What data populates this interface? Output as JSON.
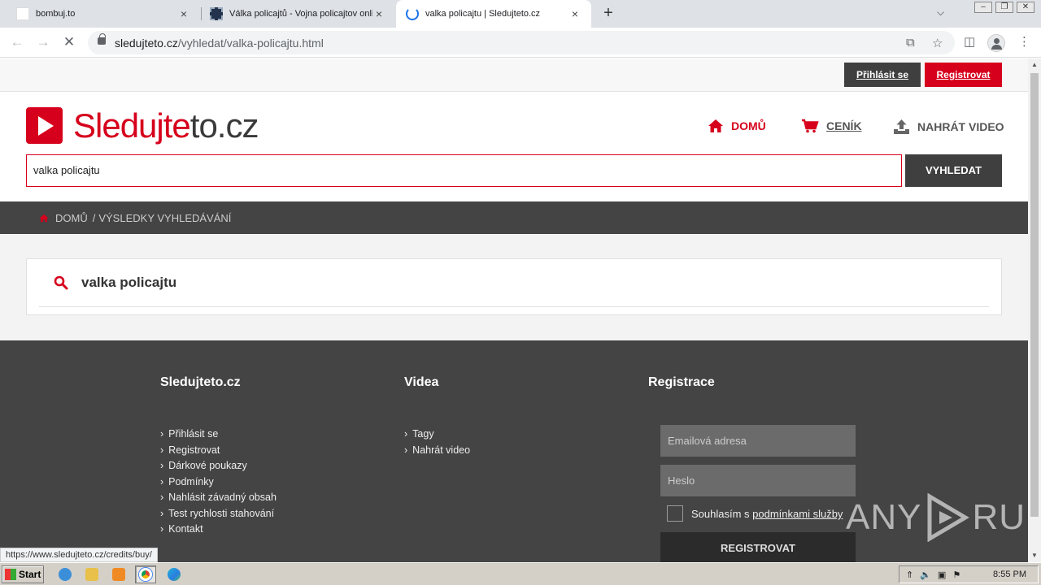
{
  "browser": {
    "tabs": [
      {
        "title": "bombuj.to",
        "close": "×"
      },
      {
        "title": "Válka policajtů - Vojna policajtov online",
        "close": "×"
      },
      {
        "title": "valka policajtu | Sledujteto.cz",
        "close": "×"
      }
    ],
    "new_tab": "+",
    "url_host": "sledujteto.cz",
    "url_path": "/vyhledat/valka-policajtu.html",
    "status_url": "https://www.sledujteto.cz/credits/buy/"
  },
  "site": {
    "logo_red": "Sledujte",
    "logo_dark": "to.cz",
    "login_label": "Přihlásit se",
    "register_label": "Registrovat",
    "nav": {
      "home": "DOMŮ",
      "pricing": "CENÍK",
      "upload": "NAHRÁT VIDEO"
    },
    "search": {
      "value": "valka policajtu",
      "button": "VYHLEDAT"
    },
    "breadcrumb": {
      "home": "DOMŮ",
      "separator": "/",
      "current": "VÝSLEDKY VYHLEDÁVÁNÍ"
    },
    "result_query": "valka policajtu",
    "accent_color": "#d6001c"
  },
  "footer": {
    "col1": {
      "title": "Sledujteto.cz",
      "links": [
        "Přihlásit se",
        "Registrovat",
        "Dárkové poukazy",
        "Podmínky",
        "Nahlásit závadný obsah",
        "Test rychlosti stahování",
        "Kontakt"
      ]
    },
    "col2": {
      "title": "Videa",
      "links": [
        "Tagy",
        "Nahrát video"
      ]
    },
    "col3": {
      "title": "Registrace",
      "email_placeholder": "Emailová adresa",
      "password_placeholder": "Heslo",
      "terms_prefix": "Souhlasím s ",
      "terms_link": "podmínkami služby",
      "register_button": "REGISTROVAT"
    }
  },
  "watermark": {
    "left": "ANY",
    "right": "RUN"
  },
  "taskbar": {
    "start": "Start",
    "clock": "8:55 PM"
  }
}
